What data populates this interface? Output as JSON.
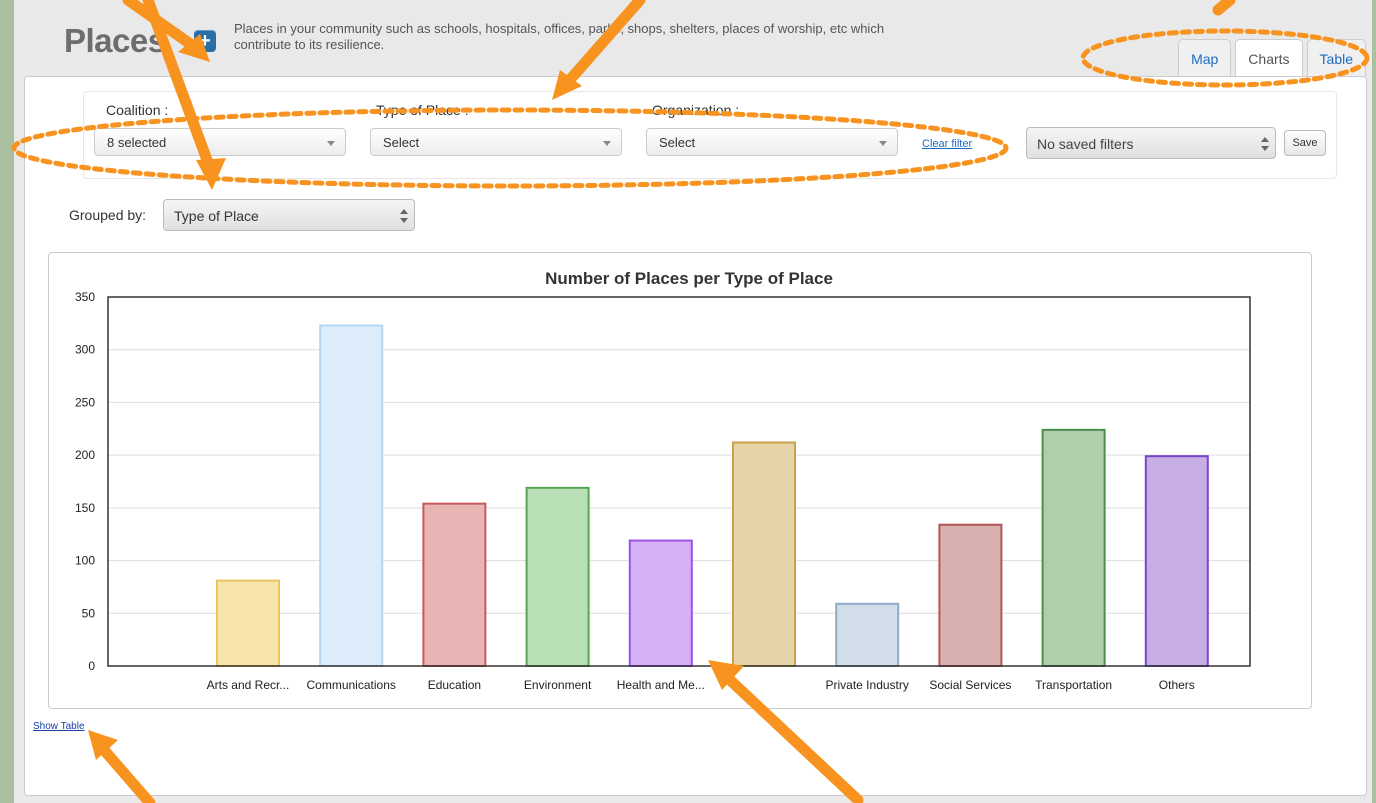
{
  "header": {
    "title": "Places",
    "add_icon": "plus-icon",
    "description": "Places in your community such as schools, hospitals, offices, parks, shops, shelters, places of worship, etc which contribute to its resilience."
  },
  "tabs": [
    {
      "label": "Map",
      "active": false
    },
    {
      "label": "Charts",
      "active": true
    },
    {
      "label": "Table",
      "active": false
    }
  ],
  "filters": {
    "coalition": {
      "label": "Coalition :",
      "value": "8 selected"
    },
    "type_of_place": {
      "label": "Type of Place :",
      "value": "Select"
    },
    "organization": {
      "label": "Organization :",
      "value": "Select"
    },
    "clear_filter": "Clear filter",
    "saved_filters": "No saved filters",
    "save_label": "Save"
  },
  "grouping": {
    "label": "Grouped by:",
    "value": "Type of Place"
  },
  "show_table": "Show Table",
  "colors": {
    "annotation": "#f7931e",
    "link": "#1a6cc0",
    "button_blue": "#2a6ea6"
  },
  "chart_data": {
    "type": "bar",
    "title": "Number of Places per Type of Place",
    "xlabel": "",
    "ylabel": "",
    "ylim": [
      0,
      350
    ],
    "yticks": [
      0,
      50,
      100,
      150,
      200,
      250,
      300,
      350
    ],
    "grid": true,
    "categories": [
      "Arts and Recr...",
      "Communications",
      "Education",
      "Environment",
      "Health and Me...",
      "",
      "Private Industry",
      "Social Services",
      "Transportation",
      "Others"
    ],
    "values": [
      81,
      323,
      154,
      169,
      119,
      212,
      59,
      134,
      224,
      199
    ],
    "fills": [
      "#f8e3ac",
      "#ddecfa",
      "#e8b4b4",
      "#b9dfb7",
      "#d4b2f5",
      "#e6d4a8",
      "#d1dde8",
      "#d9b0b0",
      "#afcfac",
      "#c7aee5"
    ],
    "strokes": [
      "#e9c45a",
      "#b6d6f2",
      "#c9585a",
      "#57a554",
      "#9b53e6",
      "#c9a24a",
      "#90abc8",
      "#b45457",
      "#4e8c4b",
      "#7a45cc"
    ]
  }
}
